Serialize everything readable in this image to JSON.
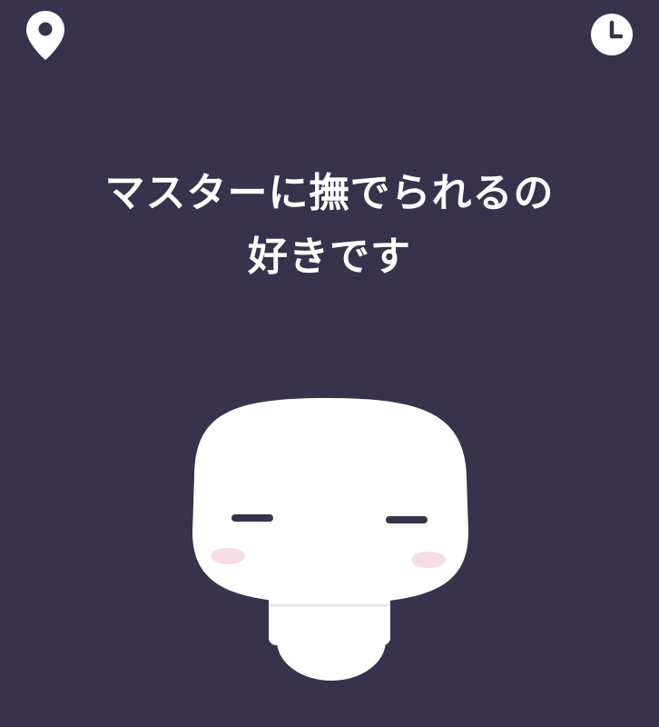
{
  "header": {
    "left_icon": "location-pin-icon",
    "right_icon": "clock-icon"
  },
  "message": {
    "line1": "マスターに撫でられるの",
    "line2": "好きです"
  },
  "colors": {
    "background": "#38324c",
    "text": "#ffffff",
    "character_body": "#ffffff",
    "character_eyes": "#38324c",
    "character_cheeks": "#f6dde4"
  }
}
